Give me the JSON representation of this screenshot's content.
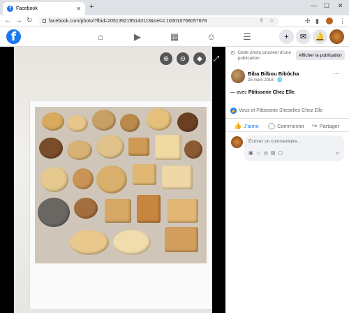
{
  "browser": {
    "tab_title": "Facebook",
    "tab_favicon": "f",
    "url": "facebook.com/photo/?fbid=2051392195143113&set=t.100010768057678"
  },
  "fb": {
    "logo": "f"
  },
  "panel": {
    "notice": "Cette photo provient d’une publication.",
    "show_post": "Afficher la publication",
    "author": "Biba Bilbou Bibôcha",
    "date": "25 mars 2018 · ",
    "caption_prefix": "— avec ",
    "caption_link": "Pâtisserie Chez Elle",
    "caption_suffix": ".",
    "reactions": "Vous et Pâtisserie Sheselles Chez Elle",
    "like": "J’aime",
    "comment": "Commenter",
    "share": "Partager",
    "comment_placeholder": "Écrivez un commentaire…"
  },
  "colors": {
    "brand": "#1877f2"
  }
}
